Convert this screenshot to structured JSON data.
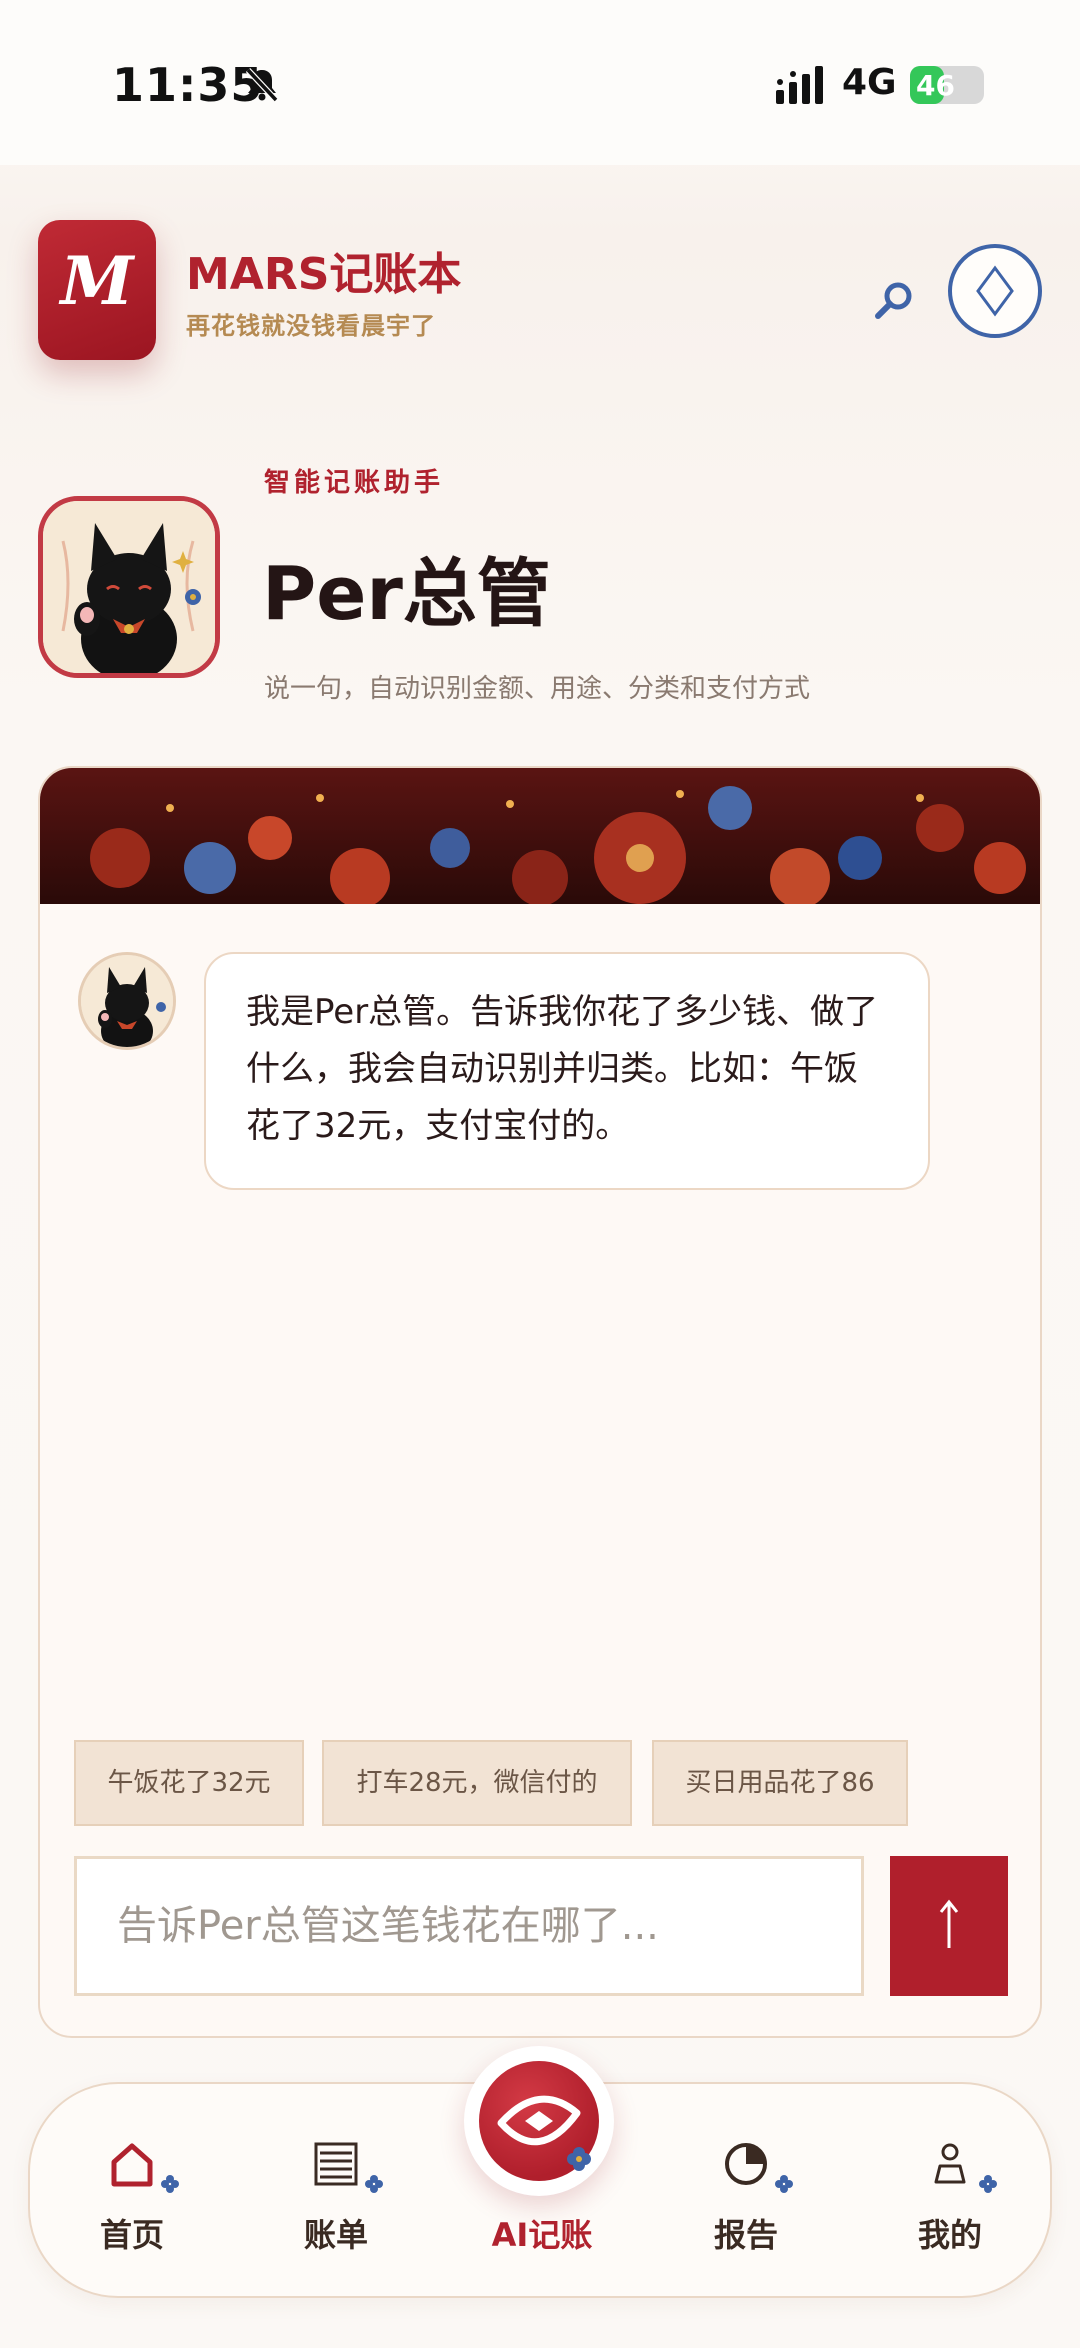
{
  "status_bar": {
    "time": "11:35",
    "network": "4G",
    "battery": "46",
    "battery_level": 0.46
  },
  "header": {
    "logo_letter": "M",
    "title": "MARS记账本",
    "subtitle": "再花钱就没钱看晨宇了"
  },
  "assistant": {
    "kicker": "智能记账助手",
    "name": "Per总管",
    "description": "说一句，自动识别金额、用途、分类和支付方式"
  },
  "chat": {
    "bot_message": "我是Per总管。告诉我你花了多少钱、做了什么，我会自动识别并归类。比如：午饭花了32元，支付宝付的。",
    "suggestions": [
      "午饭花了32元",
      "打车28元，微信付的",
      "买日用品花了86"
    ],
    "input_placeholder": "告诉Per总管这笔钱花在哪了..."
  },
  "tabbar": {
    "tabs": [
      {
        "label": "首页",
        "icon": "home-icon"
      },
      {
        "label": "账单",
        "icon": "list-icon"
      },
      {
        "label": "AI记账",
        "icon": "ai-logo-icon",
        "active": true
      },
      {
        "label": "报告",
        "icon": "pie-chart-icon"
      },
      {
        "label": "我的",
        "icon": "person-icon"
      }
    ]
  },
  "colors": {
    "accent": "#b0222e",
    "gold": "#b58a52",
    "blue": "#3f64a8",
    "background": "#fbf8f5"
  }
}
